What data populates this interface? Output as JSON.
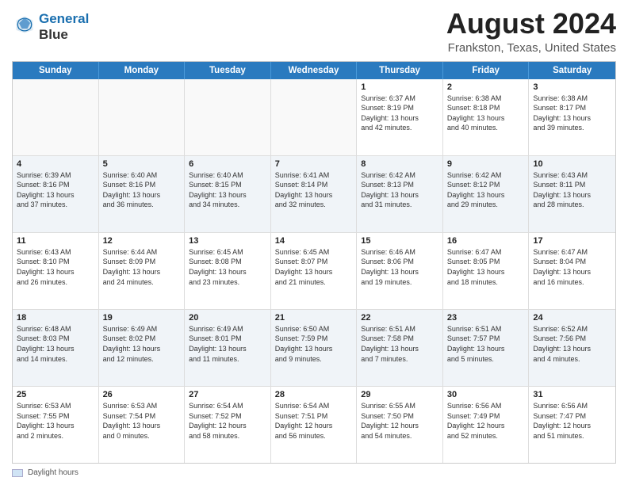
{
  "header": {
    "logo_line1": "General",
    "logo_line2": "Blue",
    "main_title": "August 2024",
    "subtitle": "Frankston, Texas, United States"
  },
  "calendar": {
    "days_of_week": [
      "Sunday",
      "Monday",
      "Tuesday",
      "Wednesday",
      "Thursday",
      "Friday",
      "Saturday"
    ],
    "rows": [
      [
        {
          "day": "",
          "text": "",
          "empty": true
        },
        {
          "day": "",
          "text": "",
          "empty": true
        },
        {
          "day": "",
          "text": "",
          "empty": true
        },
        {
          "day": "",
          "text": "",
          "empty": true
        },
        {
          "day": "1",
          "text": "Sunrise: 6:37 AM\nSunset: 8:19 PM\nDaylight: 13 hours\nand 42 minutes."
        },
        {
          "day": "2",
          "text": "Sunrise: 6:38 AM\nSunset: 8:18 PM\nDaylight: 13 hours\nand 40 minutes."
        },
        {
          "day": "3",
          "text": "Sunrise: 6:38 AM\nSunset: 8:17 PM\nDaylight: 13 hours\nand 39 minutes."
        }
      ],
      [
        {
          "day": "4",
          "text": "Sunrise: 6:39 AM\nSunset: 8:16 PM\nDaylight: 13 hours\nand 37 minutes."
        },
        {
          "day": "5",
          "text": "Sunrise: 6:40 AM\nSunset: 8:16 PM\nDaylight: 13 hours\nand 36 minutes."
        },
        {
          "day": "6",
          "text": "Sunrise: 6:40 AM\nSunset: 8:15 PM\nDaylight: 13 hours\nand 34 minutes."
        },
        {
          "day": "7",
          "text": "Sunrise: 6:41 AM\nSunset: 8:14 PM\nDaylight: 13 hours\nand 32 minutes."
        },
        {
          "day": "8",
          "text": "Sunrise: 6:42 AM\nSunset: 8:13 PM\nDaylight: 13 hours\nand 31 minutes."
        },
        {
          "day": "9",
          "text": "Sunrise: 6:42 AM\nSunset: 8:12 PM\nDaylight: 13 hours\nand 29 minutes."
        },
        {
          "day": "10",
          "text": "Sunrise: 6:43 AM\nSunset: 8:11 PM\nDaylight: 13 hours\nand 28 minutes."
        }
      ],
      [
        {
          "day": "11",
          "text": "Sunrise: 6:43 AM\nSunset: 8:10 PM\nDaylight: 13 hours\nand 26 minutes."
        },
        {
          "day": "12",
          "text": "Sunrise: 6:44 AM\nSunset: 8:09 PM\nDaylight: 13 hours\nand 24 minutes."
        },
        {
          "day": "13",
          "text": "Sunrise: 6:45 AM\nSunset: 8:08 PM\nDaylight: 13 hours\nand 23 minutes."
        },
        {
          "day": "14",
          "text": "Sunrise: 6:45 AM\nSunset: 8:07 PM\nDaylight: 13 hours\nand 21 minutes."
        },
        {
          "day": "15",
          "text": "Sunrise: 6:46 AM\nSunset: 8:06 PM\nDaylight: 13 hours\nand 19 minutes."
        },
        {
          "day": "16",
          "text": "Sunrise: 6:47 AM\nSunset: 8:05 PM\nDaylight: 13 hours\nand 18 minutes."
        },
        {
          "day": "17",
          "text": "Sunrise: 6:47 AM\nSunset: 8:04 PM\nDaylight: 13 hours\nand 16 minutes."
        }
      ],
      [
        {
          "day": "18",
          "text": "Sunrise: 6:48 AM\nSunset: 8:03 PM\nDaylight: 13 hours\nand 14 minutes."
        },
        {
          "day": "19",
          "text": "Sunrise: 6:49 AM\nSunset: 8:02 PM\nDaylight: 13 hours\nand 12 minutes."
        },
        {
          "day": "20",
          "text": "Sunrise: 6:49 AM\nSunset: 8:01 PM\nDaylight: 13 hours\nand 11 minutes."
        },
        {
          "day": "21",
          "text": "Sunrise: 6:50 AM\nSunset: 7:59 PM\nDaylight: 13 hours\nand 9 minutes."
        },
        {
          "day": "22",
          "text": "Sunrise: 6:51 AM\nSunset: 7:58 PM\nDaylight: 13 hours\nand 7 minutes."
        },
        {
          "day": "23",
          "text": "Sunrise: 6:51 AM\nSunset: 7:57 PM\nDaylight: 13 hours\nand 5 minutes."
        },
        {
          "day": "24",
          "text": "Sunrise: 6:52 AM\nSunset: 7:56 PM\nDaylight: 13 hours\nand 4 minutes."
        }
      ],
      [
        {
          "day": "25",
          "text": "Sunrise: 6:53 AM\nSunset: 7:55 PM\nDaylight: 13 hours\nand 2 minutes."
        },
        {
          "day": "26",
          "text": "Sunrise: 6:53 AM\nSunset: 7:54 PM\nDaylight: 13 hours\nand 0 minutes."
        },
        {
          "day": "27",
          "text": "Sunrise: 6:54 AM\nSunset: 7:52 PM\nDaylight: 12 hours\nand 58 minutes."
        },
        {
          "day": "28",
          "text": "Sunrise: 6:54 AM\nSunset: 7:51 PM\nDaylight: 12 hours\nand 56 minutes."
        },
        {
          "day": "29",
          "text": "Sunrise: 6:55 AM\nSunset: 7:50 PM\nDaylight: 12 hours\nand 54 minutes."
        },
        {
          "day": "30",
          "text": "Sunrise: 6:56 AM\nSunset: 7:49 PM\nDaylight: 12 hours\nand 52 minutes."
        },
        {
          "day": "31",
          "text": "Sunrise: 6:56 AM\nSunset: 7:47 PM\nDaylight: 12 hours\nand 51 minutes."
        }
      ]
    ]
  },
  "footer": {
    "legend_label": "Daylight hours"
  }
}
